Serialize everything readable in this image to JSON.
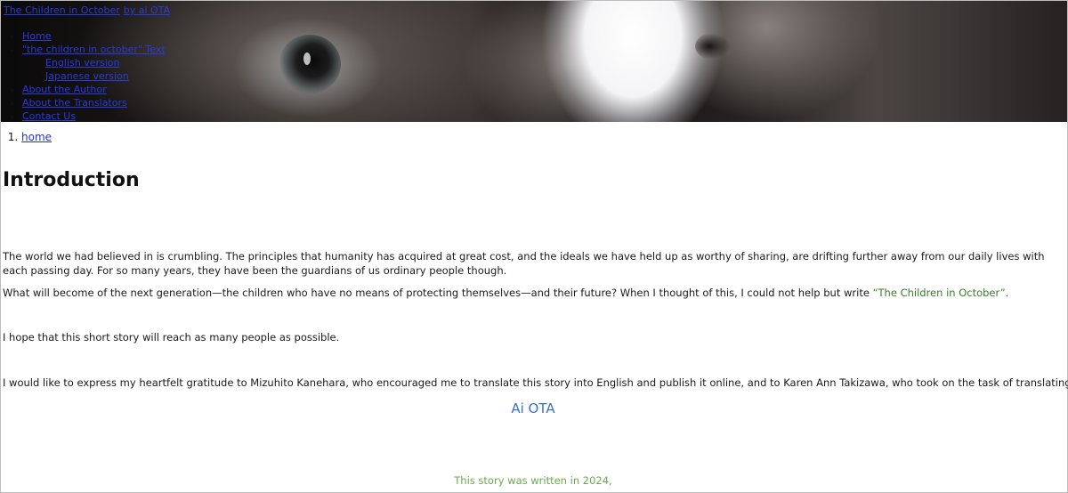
{
  "header": {
    "site_title": "The Children in October",
    "byline": "by ai OTA",
    "nav": [
      {
        "label": "Home"
      },
      {
        "label": "\"the children in october\" Text",
        "children": [
          {
            "label": "English version"
          },
          {
            "label": "Japanese version"
          }
        ]
      },
      {
        "label": "About the Author"
      },
      {
        "label": "About the Translators"
      },
      {
        "label": "Contact Us"
      }
    ]
  },
  "breadcrumb": [
    "home"
  ],
  "main": {
    "title": "Introduction",
    "paragraphs": [
      " The world we had believed in is crumbling. The principles that humanity has acquired at great cost, and the ideals we have held up as worthy of sharing, are drifting further away from our daily lives with each passing day. For so many years, they have been the guardians of us ordinary people though.",
      "What will become of the next generation—the children who have no means of protecting themselves—and their future? When I thought of this, I could not help but write ",
      "I hope that this short story will reach as many people as possible.",
      "I would like to express my heartfelt gratitude to Mizuhito Kanehara, who encouraged me to translate this story into English and publish it online, and to Karen Ann Takizawa, who took on the task of translating it."
    ],
    "story_title": "“The Children in October”",
    "period": ".",
    "signature": "Ai OTA",
    "written_note": "This story was written in 2024,"
  },
  "colors": {
    "link": "#2b3bd8",
    "story_title": "#3a7a2a",
    "signature": "#3a6fd0",
    "written_note": "#6aa84f"
  }
}
